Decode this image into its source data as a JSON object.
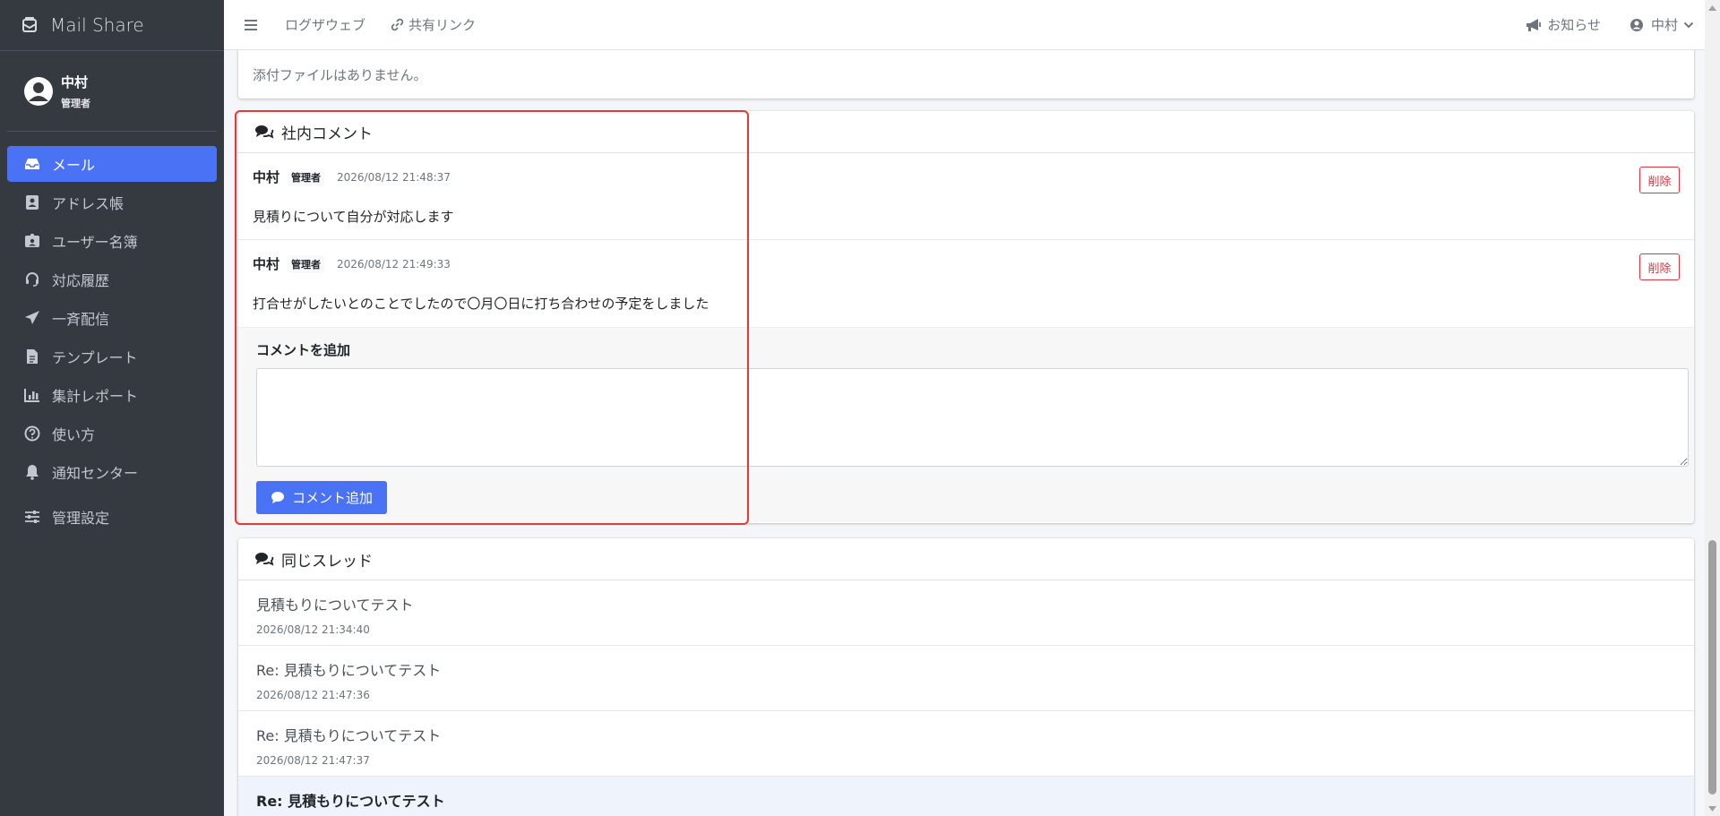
{
  "brand": {
    "name": "Mail Share",
    "icon": "mail-stack-icon"
  },
  "user": {
    "name": "中村",
    "role": "管理者"
  },
  "sidebar": {
    "items": [
      {
        "label": "メール",
        "icon": "inbox-icon",
        "active": true
      },
      {
        "label": "アドレス帳",
        "icon": "address-book-icon"
      },
      {
        "label": "ユーザー名簿",
        "icon": "id-badge-icon"
      },
      {
        "label": "対応履歴",
        "icon": "headset-icon"
      },
      {
        "label": "一斉配信",
        "icon": "paper-plane-icon"
      },
      {
        "label": "テンプレート",
        "icon": "file-text-icon"
      },
      {
        "label": "集計レポート",
        "icon": "bar-chart-icon"
      },
      {
        "label": "使い方",
        "icon": "question-circle-icon"
      },
      {
        "label": "通知センター",
        "icon": "bell-icon"
      },
      {
        "label": "管理設定",
        "icon": "sliders-icon"
      }
    ]
  },
  "topbar": {
    "links": [
      {
        "label": "ログザウェブ"
      },
      {
        "label": "共有リンク",
        "icon": "link-icon"
      }
    ],
    "notice": "お知らせ",
    "user_menu": "中村"
  },
  "attachments": {
    "empty_text": "添付ファイルはありません。"
  },
  "comments": {
    "title": "社内コメント",
    "items": [
      {
        "author": "中村",
        "role": "管理者",
        "time": "2026/08/12 21:48:37",
        "body": "見積りについて自分が対応します",
        "delete_label": "削除"
      },
      {
        "author": "中村",
        "role": "管理者",
        "time": "2026/08/12 21:49:33",
        "body": "打合せがしたいとのことでしたので〇月〇日に打ち合わせの予定をしました",
        "delete_label": "削除"
      }
    ],
    "add_label": "コメントを追加",
    "textarea_value": "",
    "add_button": "コメント追加"
  },
  "thread": {
    "title": "同じスレッド",
    "items": [
      {
        "subject": "見積もりについてテスト",
        "date": "2026/08/12 21:34:40"
      },
      {
        "subject": "Re: 見積もりについてテスト",
        "date": "2026/08/12 21:47:36"
      },
      {
        "subject": "Re: 見積もりについてテスト",
        "date": "2026/08/12 21:47:37"
      },
      {
        "subject": "Re: 見積もりについてテスト",
        "date": "",
        "current": true
      }
    ]
  },
  "colors": {
    "accent": "#4a72f5",
    "sidebar_bg": "#343a40",
    "danger": "#dc3545",
    "highlight": "#e53935"
  }
}
